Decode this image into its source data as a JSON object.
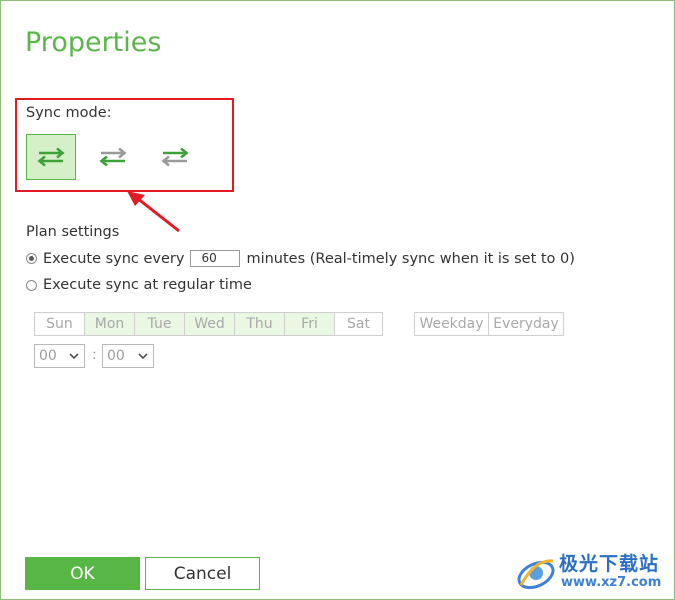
{
  "dialog": {
    "title": "Properties"
  },
  "sync_mode": {
    "label": "Sync mode:",
    "options": [
      {
        "name": "two-way-sync",
        "selected": true
      },
      {
        "name": "one-way-sync-right",
        "selected": false
      },
      {
        "name": "one-way-sync-left",
        "selected": false
      }
    ]
  },
  "plan": {
    "heading": "Plan settings",
    "every": {
      "label": "Execute sync every",
      "value": "60",
      "suffix": "minutes (Real-timely sync when it is set to 0)",
      "selected": true
    },
    "regular": {
      "label": "Execute sync at regular time",
      "selected": false
    },
    "days": [
      "Sun",
      "Mon",
      "Tue",
      "Wed",
      "Thu",
      "Fri",
      "Sat"
    ],
    "day_groups": [
      "Weekday",
      "Everyday"
    ],
    "hour": "00",
    "minute": "00",
    "separator": ":"
  },
  "buttons": {
    "ok": "OK",
    "cancel": "Cancel"
  },
  "watermark": {
    "title": "极光下载站",
    "url": "www.xz7.com"
  },
  "colors": {
    "accent": "#58b647",
    "title": "#5bb54a",
    "annotation": "#e21b23"
  }
}
